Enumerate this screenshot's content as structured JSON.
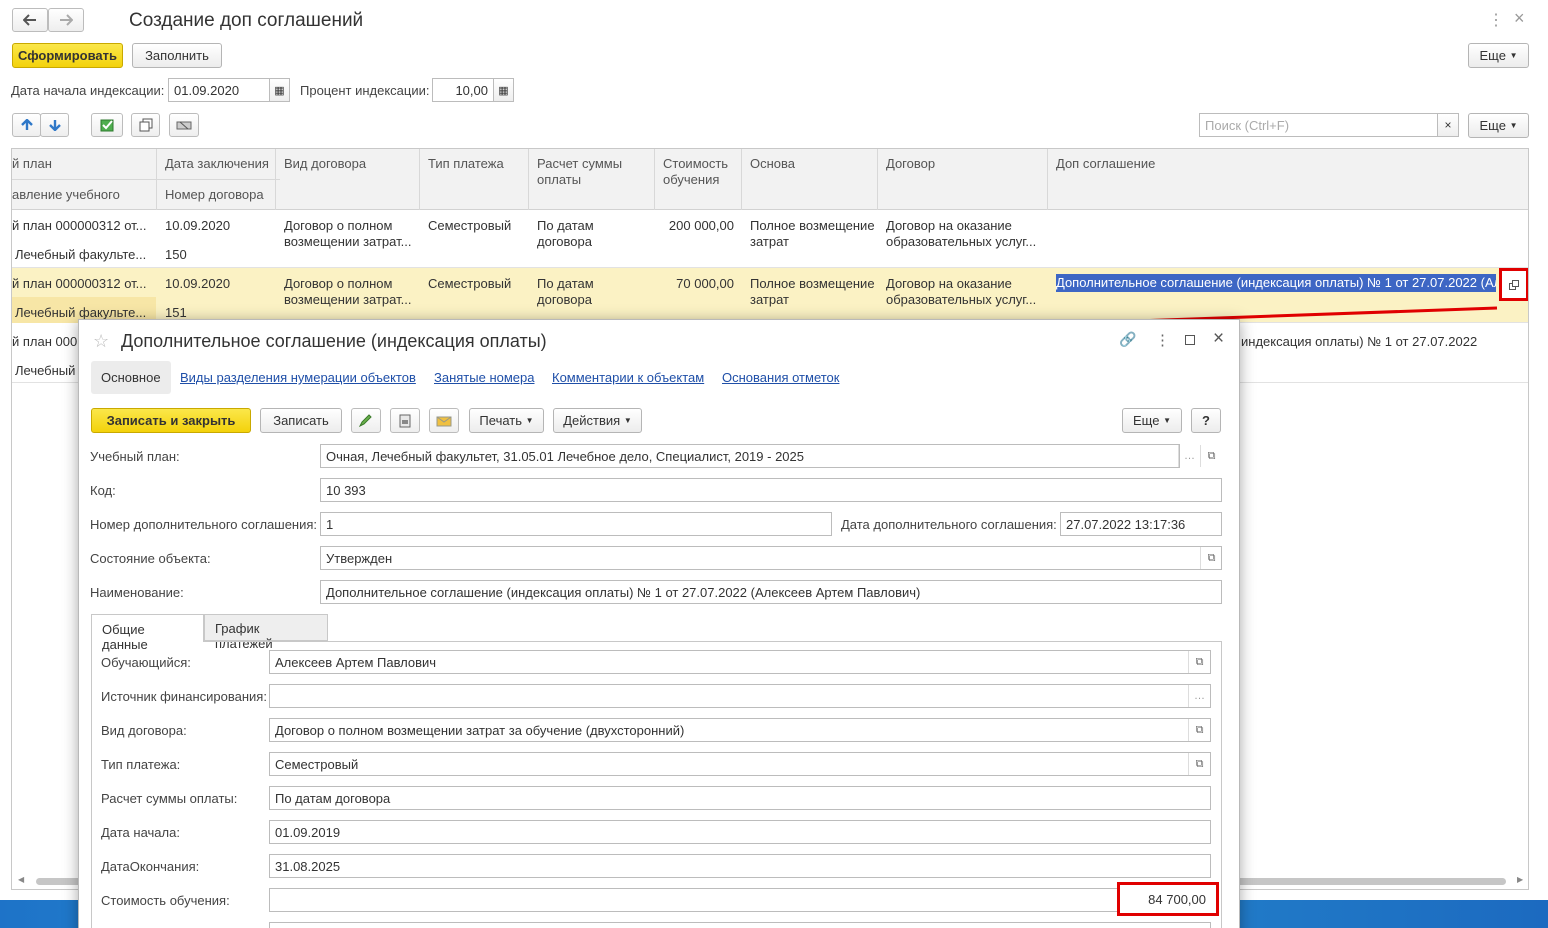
{
  "window": {
    "title": "Создание доп соглашений",
    "generate_label": "Сформировать",
    "fill_label": "Заполнить",
    "more_label": "Еще",
    "more_label2": "Еще"
  },
  "filters": {
    "start_date_label": "Дата начала индексации:",
    "start_date_value": "01.09.2020",
    "percent_label": "Процент индексации:",
    "percent_value": "10,00"
  },
  "search": {
    "placeholder": "Поиск (Ctrl+F)"
  },
  "table": {
    "headers": {
      "plan": "й план",
      "plan2": "авление учебного",
      "contract_date": "Дата заключения",
      "contract_number": "Номер договора",
      "contract_kind": "Вид договора",
      "payment_type": "Тип платежа",
      "payment_calc": "Расчет суммы оплаты",
      "cost": "Стоимость обучения",
      "basis": "Основа",
      "contract": "Договор",
      "addendum": "Доп соглашение"
    },
    "rows": [
      {
        "plan": "й план 000000312 от...",
        "plan2": "Лечебный факульте...",
        "date": "10.09.2020",
        "number": "150",
        "kind": "Договор о полном возмещении затрат...",
        "ptype": "Семестровый",
        "calc": "По датам договора",
        "cost": "200 000,00",
        "basis": "Полное возмещение затрат",
        "contract": "Договор на оказание образовательных услуг...",
        "addendum": ""
      },
      {
        "plan": "й план 000000312 от...",
        "plan2": "Лечебный факульте...",
        "date": "10.09.2020",
        "number": "151",
        "kind": "Договор о полном возмещении затрат...",
        "ptype": "Семестровый",
        "calc": "По датам договора",
        "cost": "70 000,00",
        "basis": "Полное возмещение затрат",
        "contract": "Договор на оказание образовательных услуг...",
        "addendum": "Дополнительное соглашение (индексация оплаты) № 1 от 27.07.2022 (Ал"
      },
      {
        "plan": "й план 000",
        "plan2": "Лечебный",
        "addendum": "индексация оплаты) № 1 от 27.07.2022"
      }
    ]
  },
  "dialog": {
    "title": "Дополнительное соглашение (индексация оплаты)",
    "tabs_top": [
      "Основное",
      "Виды разделения нумерации объектов",
      "Занятые номера",
      "Комментарии к объектам",
      "Основания отметок"
    ],
    "save_close_label": "Записать и закрыть",
    "save_label": "Записать",
    "print_label": "Печать",
    "actions_label": "Действия",
    "more_label": "Еще",
    "help_label": "?",
    "fields": {
      "plan_label": "Учебный план:",
      "plan_value": "Очная, Лечебный факультет, 31.05.01 Лечебное дело, Специалист, 2019 - 2025",
      "code_label": "Код:",
      "code_value": "10 393",
      "number_label": "Номер дополнительного соглашения:",
      "number_value": "1",
      "date_label": "Дата дополнительного соглашения:",
      "date_value": "27.07.2022 13:17:36",
      "state_label": "Состояние объекта:",
      "state_value": "Утвержден",
      "name_label": "Наименование:",
      "name_value": "Дополнительное соглашение (индексация оплаты) № 1 от 27.07.2022 (Алексеев Артем Павлович)"
    },
    "inner_tabs": [
      "Общие данные",
      "График платежей"
    ],
    "general": {
      "student_label": "Обучающийся:",
      "student_value": "Алексеев Артем Павлович",
      "source_label": "Источник финансирования:",
      "source_value": "",
      "kind_label": "Вид договора:",
      "kind_value": "Договор о полном возмещении затрат за обучение (двухсторонний)",
      "ptype_label": "Тип платежа:",
      "ptype_value": "Семестровый",
      "calc_label": "Расчет суммы оплаты:",
      "calc_value": "По датам договора",
      "start_label": "Дата начала:",
      "start_value": "01.09.2019",
      "end_label": "ДатаОкончания:",
      "end_value": "31.08.2025",
      "cost_label": "Стоимость обучения:",
      "cost_value": "84 700,00"
    }
  },
  "colors": {
    "highlight_row": "#fbf2c4",
    "selection": "#3d66c4",
    "accent_red": "#e00000",
    "yellow_btn": "#f5d90f"
  }
}
